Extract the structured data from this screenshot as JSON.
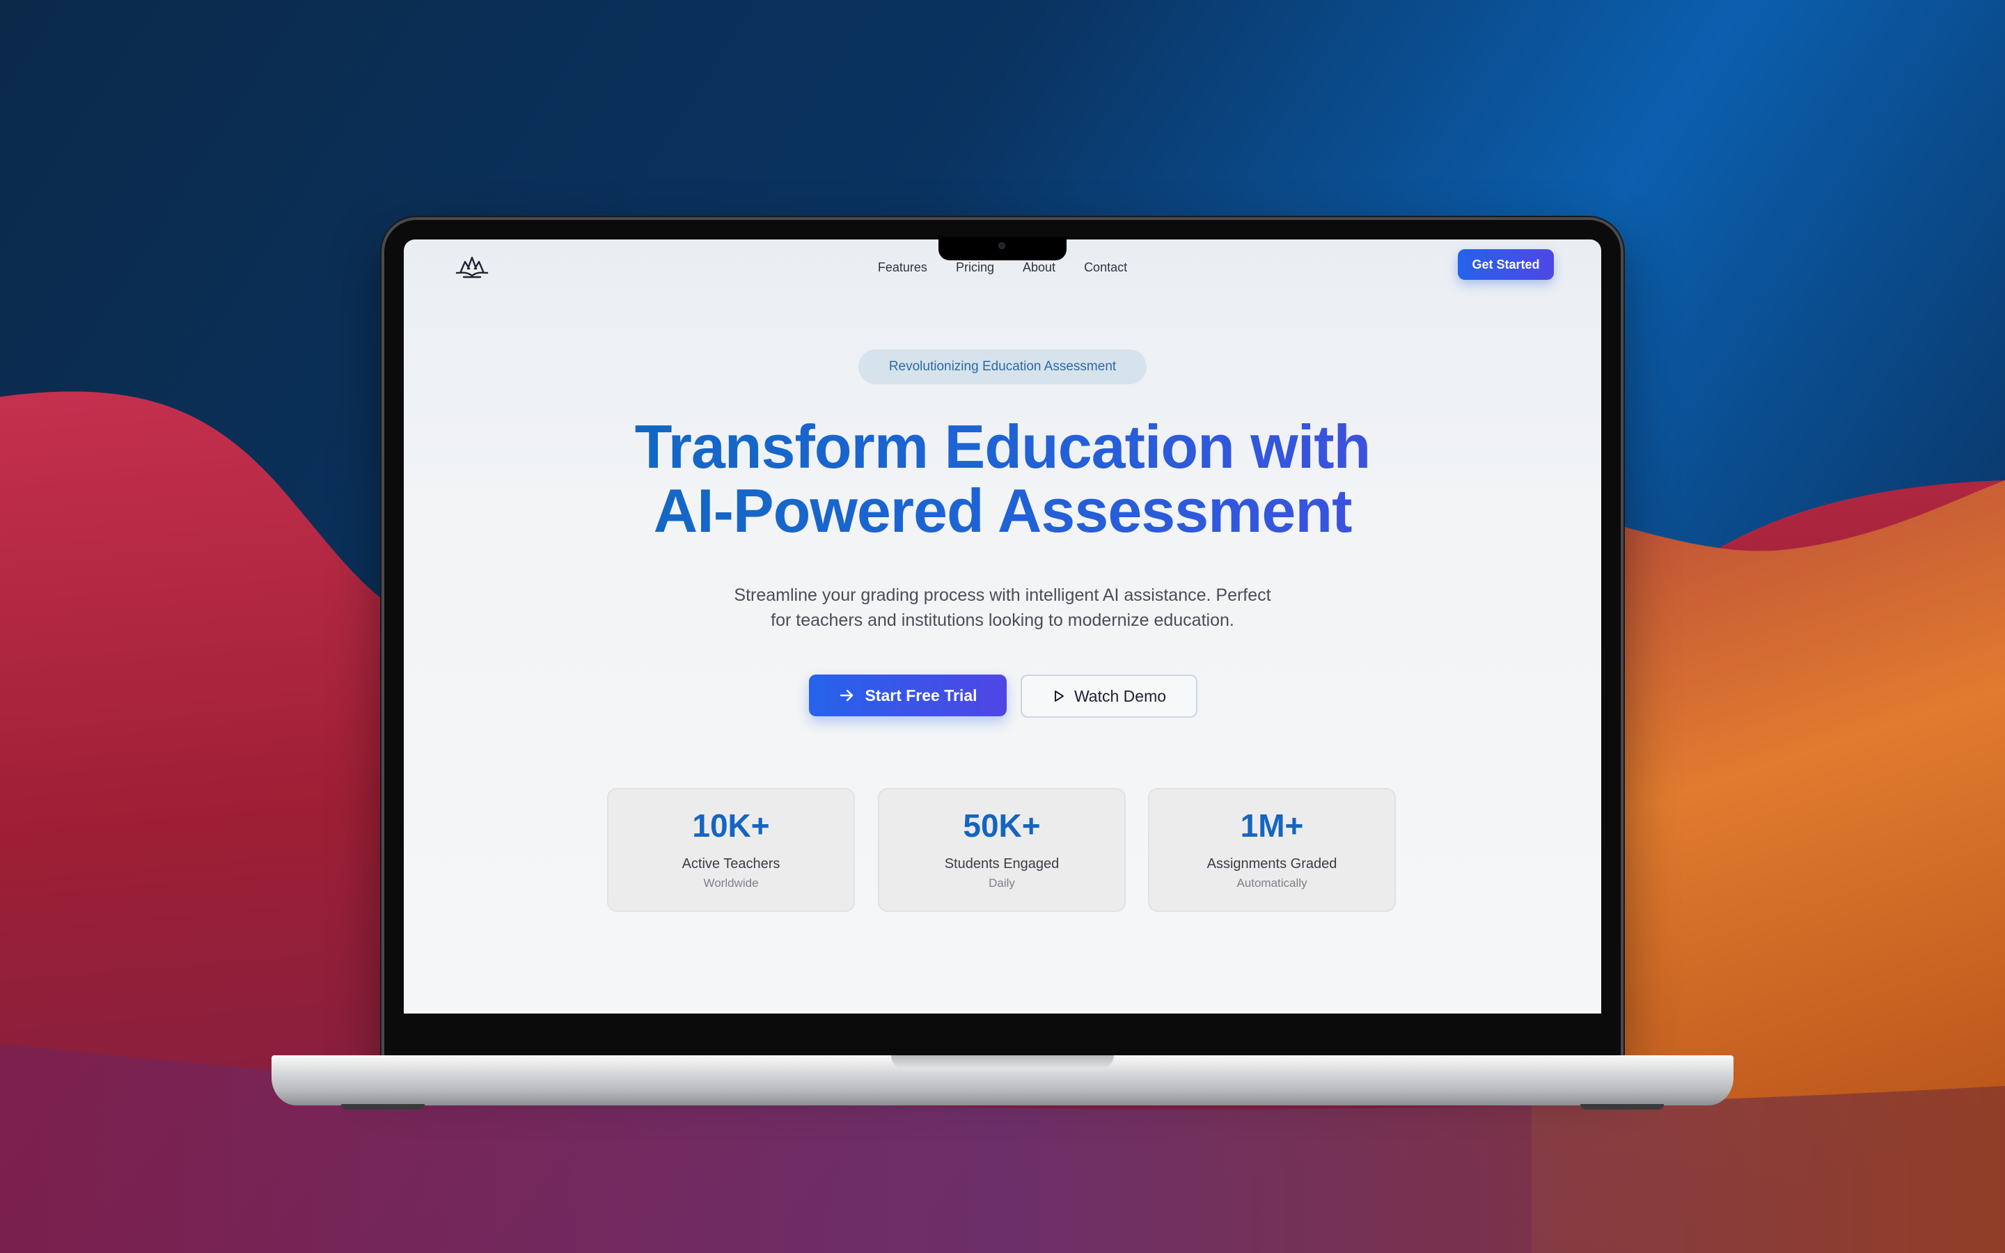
{
  "site": {
    "nav": {
      "links": [
        "Features",
        "Pricing",
        "About",
        "Contact"
      ],
      "cta_label": "Get Started"
    },
    "hero": {
      "badge": "Revolutionizing Education Assessment",
      "headline_line1": "Transform Education with",
      "headline_line2": "AI-Powered Assessment",
      "subtitle_line1": "Streamline your grading process with intelligent AI assistance. Perfect",
      "subtitle_line2": "for teachers and institutions looking to modernize education.",
      "primary_button": "Start Free Trial",
      "secondary_button": "Watch Demo"
    },
    "stats": [
      {
        "value": "10K+",
        "label": "Active Teachers",
        "sub": "Worldwide"
      },
      {
        "value": "50K+",
        "label": "Students Engaged",
        "sub": "Daily"
      },
      {
        "value": "1M+",
        "label": "Assignments Graded",
        "sub": "Automatically"
      }
    ]
  },
  "colors": {
    "accent": "#2563eb",
    "accent_end": "#4f46e5",
    "stat_value": "#1565c0",
    "badge_bg": "#d6e2ec",
    "badge_text": "#2c6aa6"
  },
  "icons": {
    "logo": "lotus-logo-icon",
    "primary_button": "arrow-right-icon",
    "secondary_button": "play-icon"
  }
}
